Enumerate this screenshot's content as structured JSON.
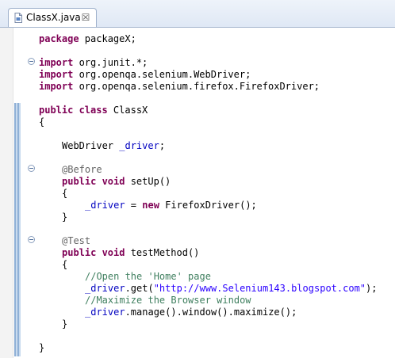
{
  "tab": {
    "label": "ClassX.java",
    "close": "☒"
  },
  "code": {
    "l1": {
      "kw": "package",
      "rest": " packageX;"
    },
    "l3": {
      "kw": "import",
      "rest": " org.junit.*;"
    },
    "l4": {
      "kw": "import",
      "rest": " org.openqa.selenium.WebDriver;"
    },
    "l5": {
      "kw": "import",
      "rest": " org.openqa.selenium.firefox.FirefoxDriver;"
    },
    "l7": {
      "kw": "public class",
      "rest": " ClassX"
    },
    "l8": "{",
    "l10": {
      "type": "WebDriver ",
      "field": "_driver",
      "end": ";"
    },
    "l12": "@Before",
    "l13": {
      "kw": "public void",
      "rest": " setUp()"
    },
    "l14": "{",
    "l15": {
      "field": "_driver",
      "mid": " = ",
      "kw": "new",
      "rest": " FirefoxDriver();"
    },
    "l16": "}",
    "l18": "@Test",
    "l19": {
      "kw": "public void",
      "rest": " testMethod()"
    },
    "l20": "{",
    "l21": "//Open the 'Home' page",
    "l22": {
      "field": "_driver",
      "mid": ".get(",
      "str": "\"http://www.Selenium143.blogspot.com\"",
      "end": ");"
    },
    "l23": "//Maximize the Browser window",
    "l24": {
      "field": "_driver",
      "rest": ".manage().window().maximize();"
    },
    "l25": "}",
    "l27": "}"
  },
  "colors": {
    "keyword": "#7f0055",
    "field": "#0000c0",
    "annotation": "#646464",
    "string": "#2a00ff",
    "comment": "#3f7f5f"
  },
  "icons": {
    "tab_icon": "java-file-icon",
    "close_icon": "close-icon",
    "fold_icon": "fold-toggle-icon"
  }
}
